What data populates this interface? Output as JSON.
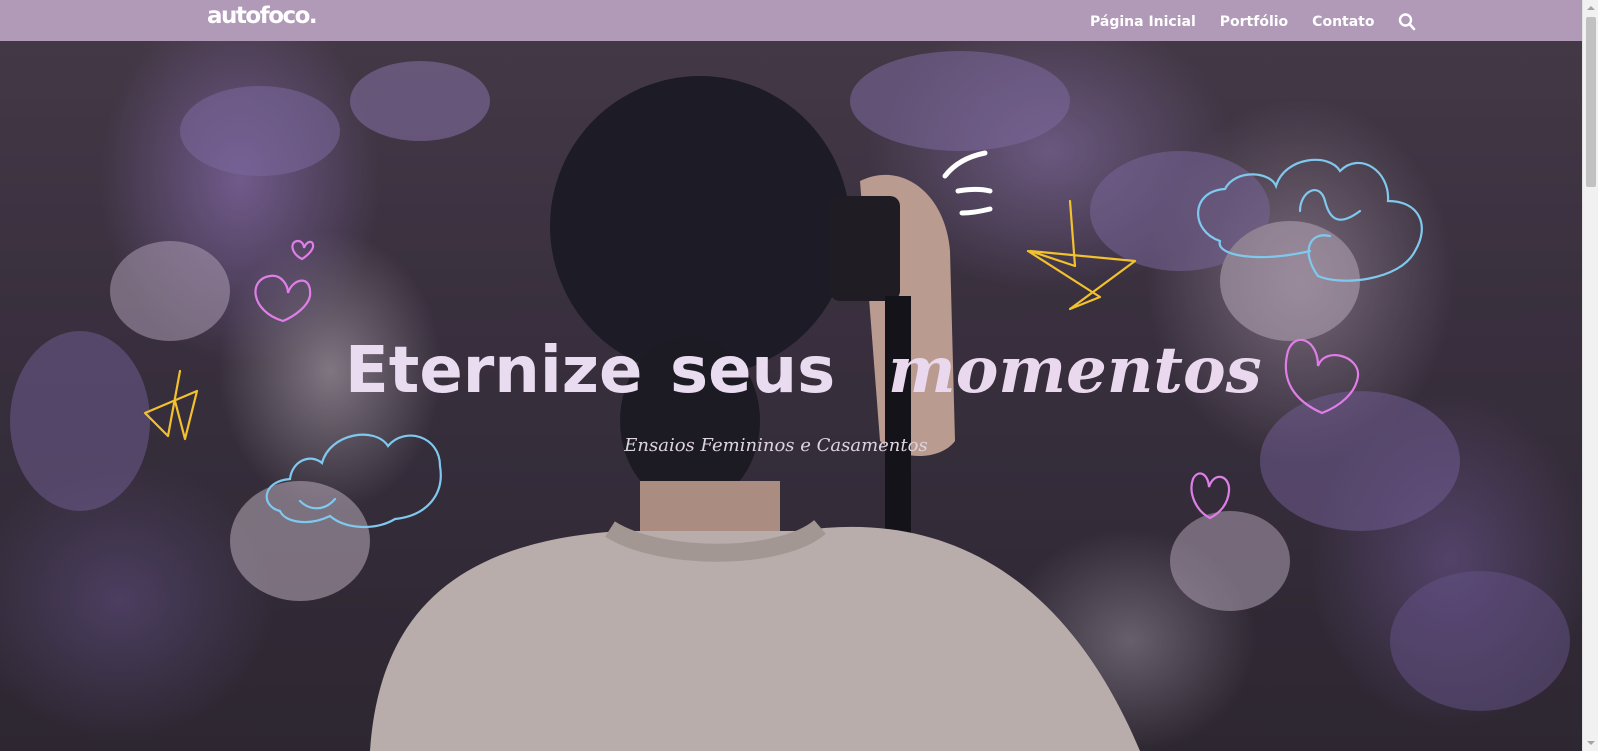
{
  "header": {
    "logo": "autofoco.",
    "nav": [
      "Página Inicial",
      "Portfólio",
      "Contato"
    ],
    "search_icon": "search-icon",
    "background_color": "#b199b8"
  },
  "hero": {
    "headline": [
      "Eternize",
      "seus",
      "momentos"
    ],
    "subtitle": "Ensaios Femininos e Casamentos",
    "headline_color": "#eadcf0",
    "doodle_colors": {
      "heart": "#e07ee8",
      "star": "#f2c12e",
      "cloud": "#7fc9ef",
      "sparkle": "#ffffff"
    }
  }
}
